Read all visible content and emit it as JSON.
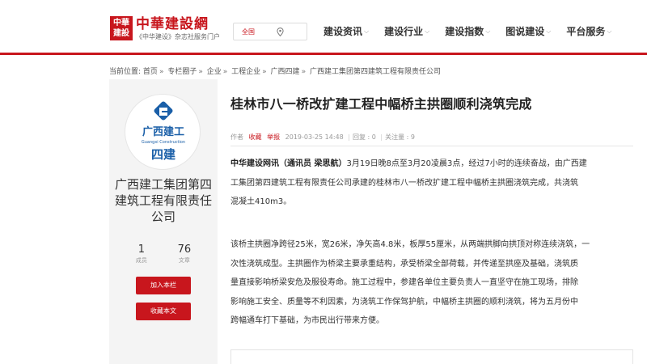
{
  "header": {
    "logo_seal": "中華建設",
    "logo_title": "中華建設網",
    "logo_subtitle": "《中华建设》杂志社服务门户",
    "region": "全国",
    "nav": [
      {
        "label": "建设资讯"
      },
      {
        "label": "建设行业"
      },
      {
        "label": "建设指数"
      },
      {
        "label": "图说建设"
      },
      {
        "label": "平台服务"
      }
    ]
  },
  "breadcrumb": {
    "prefix": "当前位置:",
    "items": [
      "首页",
      "专栏圈子",
      "企业",
      "工程企业",
      "广西四建",
      "广西建工集团第四建筑工程有限责任公司"
    ],
    "separator": "»"
  },
  "sidebar": {
    "logo_cn": "广西建工",
    "logo_en": "Guangxi Construction",
    "logo_sub": "四建",
    "company_name": "广西建工集团第四建筑工程有限责任公司",
    "members_count": "1",
    "members_label": "成员",
    "articles_count": "76",
    "articles_label": "文章",
    "join_button": "加入本栏",
    "favorite_button": "收藏本文"
  },
  "article": {
    "title": "桂林市八一桥改扩建工程中幅桥主拱圈顺利浇筑完成",
    "meta": {
      "author_label": "作者",
      "favorite": "收藏",
      "report": "举报",
      "date": "2019-03-25 14:48",
      "comments": "回复 : 0",
      "follows": "关注量 : 9"
    },
    "para1_lead": "中华建设网讯（通讯员 梁思航）",
    "para1_line1": "3月19日晚8点至3月20凌晨3点，经过7小时的连续奋战，由广西建",
    "para1_line2": "工集团第四建筑工程有限责任公司承建的桂林市八一桥改扩建工程中幅桥主拱圈浇筑完成，共浇筑",
    "para1_line3": "混凝土410m3。",
    "para2_lines": [
      "该桥主拱圈净跨径25米，宽26米，净矢高4.8米，板厚55厘米，从两端拱脚向拱顶对称连续浇筑，一",
      "次性浇筑成型。主拱圈作为桥梁主要承重结构，承受桥梁全部荷载，并传递至拱座及基础，浇筑质",
      "量直接影响桥梁安危及服役寿命。施工过程中，参建各单位主要负责人一直坚守在施工现场，排除",
      "影响施工安全、质量等不利因素，为浇筑工作保驾护航，中幅桥主拱圈的顺利浇筑，将为五月份中",
      "跨幅通车打下基础，为市民出行带来方便。"
    ]
  },
  "colors": {
    "brand_red": "#c8161d",
    "logo_blue": "#1a5fa8"
  },
  "icons": [
    "location-pin-icon",
    "chevron-down-icon"
  ]
}
